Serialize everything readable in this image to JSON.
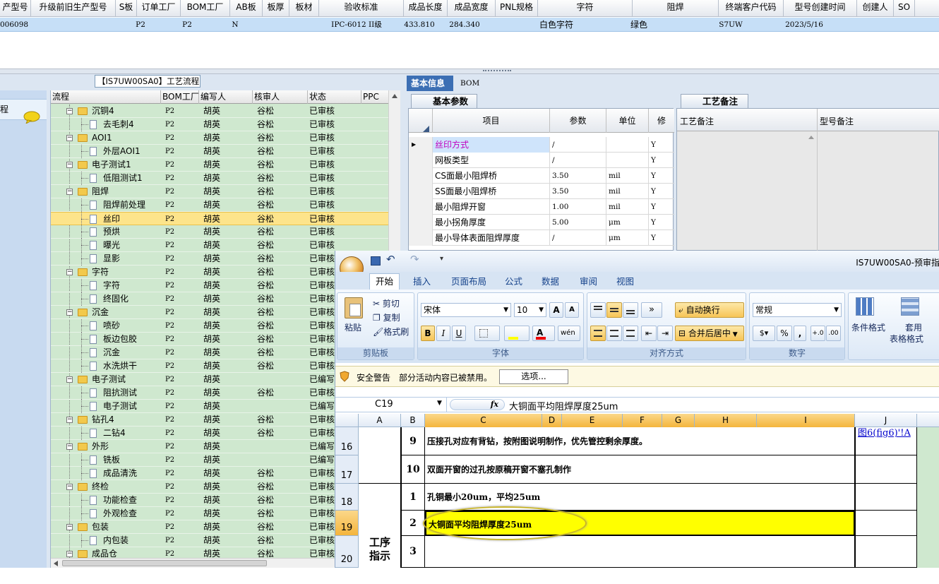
{
  "top_grid": {
    "headers": [
      "产型号",
      "升级前旧生产型号",
      "S板",
      "订单工厂",
      "BOM工厂",
      "AB板",
      "板厚",
      "板材",
      "验收标准",
      "成品长度",
      "成品宽度",
      "PNL规格",
      "字符",
      "阻焊",
      "终端客户代码",
      "型号创建时间",
      "创建人",
      "SO"
    ],
    "row": {
      "model": "006098",
      "s_board": "P2",
      "order_factory": "P2",
      "bom_factory": "N",
      "standard": "IPC-6012 II级",
      "length": "433.810",
      "width": "284.340",
      "silkscreen": "白色字符",
      "solder_mask": "绿色",
      "customer_code": "S7UW",
      "created": "2023/5/16"
    }
  },
  "workflow": {
    "title": "【IS7UW00SA0】工艺流程",
    "nav_label": "程",
    "columns": [
      "流程",
      "BOM工厂",
      "编写人",
      "核审人",
      "状态",
      "PPC"
    ],
    "rows": [
      {
        "name": "沉铜4",
        "bom": "P2",
        "writer": "胡英",
        "reviewer": "谷松",
        "status": "已审核",
        "level": 0,
        "folder": true
      },
      {
        "name": "去毛刺4",
        "bom": "P2",
        "writer": "胡英",
        "reviewer": "谷松",
        "status": "已审核",
        "level": 1,
        "folder": false
      },
      {
        "name": "AOI1",
        "bom": "P2",
        "writer": "胡英",
        "reviewer": "谷松",
        "status": "已审核",
        "level": 0,
        "folder": true
      },
      {
        "name": "外层AOI1",
        "bom": "P2",
        "writer": "胡英",
        "reviewer": "谷松",
        "status": "已审核",
        "level": 1,
        "folder": false
      },
      {
        "name": "电子测试1",
        "bom": "P2",
        "writer": "胡英",
        "reviewer": "谷松",
        "status": "已审核",
        "level": 0,
        "folder": true
      },
      {
        "name": "低阻测试1",
        "bom": "P2",
        "writer": "胡英",
        "reviewer": "谷松",
        "status": "已审核",
        "level": 1,
        "folder": false
      },
      {
        "name": "阻焊",
        "bom": "P2",
        "writer": "胡英",
        "reviewer": "谷松",
        "status": "已审核",
        "level": 0,
        "folder": true
      },
      {
        "name": "阻焊前处理",
        "bom": "P2",
        "writer": "胡英",
        "reviewer": "谷松",
        "status": "已审核",
        "level": 1,
        "folder": false
      },
      {
        "name": "丝印",
        "bom": "P2",
        "writer": "胡英",
        "reviewer": "谷松",
        "status": "已审核",
        "level": 1,
        "folder": false,
        "selected": true
      },
      {
        "name": "预烘",
        "bom": "P2",
        "writer": "胡英",
        "reviewer": "谷松",
        "status": "已审核",
        "level": 1,
        "folder": false
      },
      {
        "name": "曝光",
        "bom": "P2",
        "writer": "胡英",
        "reviewer": "谷松",
        "status": "已审核",
        "level": 1,
        "folder": false
      },
      {
        "name": "显影",
        "bom": "P2",
        "writer": "胡英",
        "reviewer": "谷松",
        "status": "已审核",
        "level": 1,
        "folder": false
      },
      {
        "name": "字符",
        "bom": "P2",
        "writer": "胡英",
        "reviewer": "谷松",
        "status": "已审核",
        "level": 0,
        "folder": true
      },
      {
        "name": "字符",
        "bom": "P2",
        "writer": "胡英",
        "reviewer": "谷松",
        "status": "已审核",
        "level": 1,
        "folder": false
      },
      {
        "name": "终固化",
        "bom": "P2",
        "writer": "胡英",
        "reviewer": "谷松",
        "status": "已审核",
        "level": 1,
        "folder": false
      },
      {
        "name": "沉金",
        "bom": "P2",
        "writer": "胡英",
        "reviewer": "谷松",
        "status": "已审核",
        "level": 0,
        "folder": true
      },
      {
        "name": "喷砂",
        "bom": "P2",
        "writer": "胡英",
        "reviewer": "谷松",
        "status": "已审核",
        "level": 1,
        "folder": false
      },
      {
        "name": "板边包胶",
        "bom": "P2",
        "writer": "胡英",
        "reviewer": "谷松",
        "status": "已审核",
        "level": 1,
        "folder": false
      },
      {
        "name": "沉金",
        "bom": "P2",
        "writer": "胡英",
        "reviewer": "谷松",
        "status": "已审核",
        "level": 1,
        "folder": false
      },
      {
        "name": "水洗烘干",
        "bom": "P2",
        "writer": "胡英",
        "reviewer": "谷松",
        "status": "已审核",
        "level": 1,
        "folder": false
      },
      {
        "name": "电子测试",
        "bom": "P2",
        "writer": "胡英",
        "reviewer": "",
        "status": "已编写",
        "level": 0,
        "folder": true
      },
      {
        "name": "阻抗测试",
        "bom": "P2",
        "writer": "胡英",
        "reviewer": "谷松",
        "status": "已审核",
        "level": 1,
        "folder": false
      },
      {
        "name": "电子测试",
        "bom": "P2",
        "writer": "胡英",
        "reviewer": "",
        "status": "已编写",
        "level": 1,
        "folder": false
      },
      {
        "name": "钻孔4",
        "bom": "P2",
        "writer": "胡英",
        "reviewer": "谷松",
        "status": "已审核",
        "level": 0,
        "folder": true
      },
      {
        "name": "二钻4",
        "bom": "P2",
        "writer": "胡英",
        "reviewer": "谷松",
        "status": "已审核",
        "level": 1,
        "folder": false
      },
      {
        "name": "外形",
        "bom": "P2",
        "writer": "胡英",
        "reviewer": "",
        "status": "已编写",
        "level": 0,
        "folder": true
      },
      {
        "name": "铣板",
        "bom": "P2",
        "writer": "胡英",
        "reviewer": "",
        "status": "已编写",
        "level": 1,
        "folder": false
      },
      {
        "name": "成品清洗",
        "bom": "P2",
        "writer": "胡英",
        "reviewer": "谷松",
        "status": "已审核",
        "level": 1,
        "folder": false
      },
      {
        "name": "终检",
        "bom": "P2",
        "writer": "胡英",
        "reviewer": "谷松",
        "status": "已审核",
        "level": 0,
        "folder": true
      },
      {
        "name": "功能检查",
        "bom": "P2",
        "writer": "胡英",
        "reviewer": "谷松",
        "status": "已审核",
        "level": 1,
        "folder": false
      },
      {
        "name": "外观检查",
        "bom": "P2",
        "writer": "胡英",
        "reviewer": "谷松",
        "status": "已审核",
        "level": 1,
        "folder": false
      },
      {
        "name": "包装",
        "bom": "P2",
        "writer": "胡英",
        "reviewer": "谷松",
        "status": "已审核",
        "level": 0,
        "folder": true
      },
      {
        "name": "内包装",
        "bom": "P2",
        "writer": "胡英",
        "reviewer": "谷松",
        "status": "已审核",
        "level": 1,
        "folder": false
      },
      {
        "name": "成品仓",
        "bom": "P2",
        "writer": "胡英",
        "reviewer": "谷松",
        "status": "已审核",
        "level": 0,
        "folder": true
      }
    ]
  },
  "info": {
    "tabs": [
      "基本信息",
      "BOM"
    ],
    "group_title": "基本参数",
    "columns": [
      "项目",
      "参数",
      "单位",
      "修"
    ],
    "rows": [
      {
        "item": "丝印方式",
        "value": "/",
        "unit": "",
        "flag": "Y",
        "current": true
      },
      {
        "item": "网板类型",
        "value": "/",
        "unit": "",
        "flag": "Y"
      },
      {
        "item": "CS面最小阻焊桥",
        "value": "3.50",
        "unit": "mil",
        "flag": "Y"
      },
      {
        "item": "SS面最小阻焊桥",
        "value": "3.50",
        "unit": "mil",
        "flag": "Y"
      },
      {
        "item": "最小阻焊开窗",
        "value": "1.00",
        "unit": "mil",
        "flag": "Y"
      },
      {
        "item": "最小拐角厚度",
        "value": "5.00",
        "unit": "μm",
        "flag": "Y"
      },
      {
        "item": "最小导体表面阻焊厚度",
        "value": "/",
        "unit": "μm",
        "flag": "Y"
      }
    ],
    "remark_title": "工艺备注",
    "remark_columns": [
      "工艺备注",
      "型号备注"
    ]
  },
  "excel": {
    "window_title": "IS7UW00SA0-预审指",
    "tabs": [
      "开始",
      "插入",
      "页面布局",
      "公式",
      "数据",
      "审阅",
      "视图"
    ],
    "clipboard": {
      "paste": "粘贴",
      "cut": "剪切",
      "copy": "复制",
      "painter": "格式刷",
      "label": "剪贴板"
    },
    "font": {
      "name": "宋体",
      "size": "10",
      "label": "字体",
      "bold": "B",
      "italic": "I",
      "underline": "U"
    },
    "align": {
      "wrap": "自动换行",
      "merge": "合并后居中",
      "label": "对齐方式"
    },
    "number": {
      "format": "常规",
      "label": "数字",
      "percent": "%",
      "comma": ","
    },
    "styles": {
      "cond": "条件格式",
      "table1": "套用",
      "table2": "表格格式"
    },
    "security": {
      "label": "安全警告",
      "message": "部分活动内容已被禁用。",
      "options": "选项..."
    },
    "name_box": "C19",
    "fx": "fx",
    "formula": "大铜面平均阻焊厚度25um",
    "columns": [
      "A",
      "B",
      "C",
      "D",
      "E",
      "F",
      "G",
      "H",
      "I",
      "J"
    ],
    "rows": [
      {
        "num": "16",
        "b": "9",
        "c": "压接孔对应有背钻，按附图说明制作，优先管控剩余厚度。",
        "j": "图6(fig6)'!A"
      },
      {
        "num": "17",
        "b": "10",
        "c": "双面开窗的过孔按原稿开窗不塞孔制作",
        "j": ""
      },
      {
        "num": "18",
        "b": "1",
        "c": "孔铜最小20um，平均25um",
        "j": ""
      },
      {
        "num": "19",
        "b": "2",
        "c": "大铜面平均阻焊厚度25um",
        "j": "",
        "active": true
      },
      {
        "num": "20",
        "b": "3",
        "c": "",
        "j": ""
      }
    ],
    "merged_a": "工序指示",
    "highlight_color": "#ffff00"
  }
}
